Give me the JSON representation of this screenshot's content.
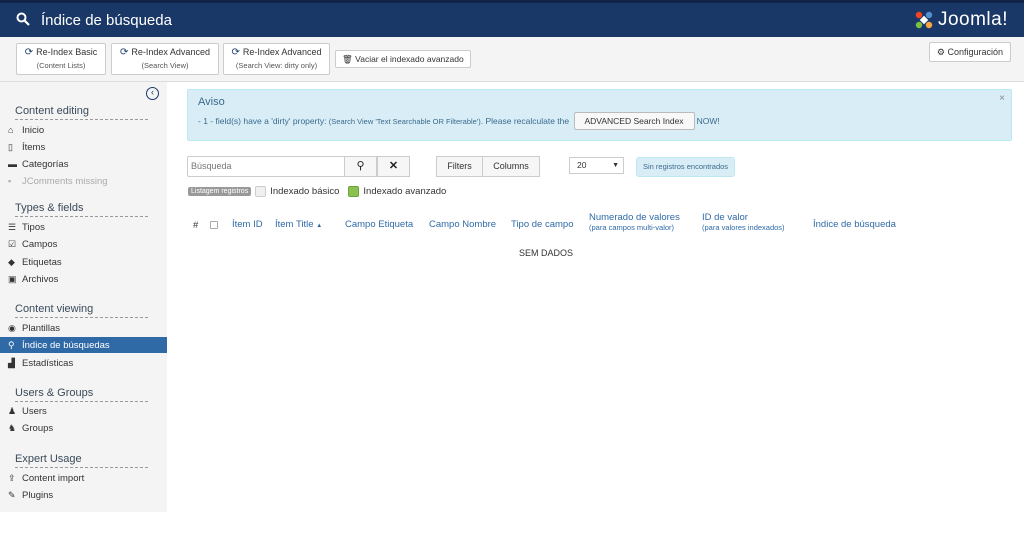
{
  "header": {
    "title": "Índice de búsqueda",
    "logo_text": "Joomla!"
  },
  "toolbar": {
    "btn_reindex_basic": {
      "label": "Re-Index Basic",
      "sub": "(Content Lists)"
    },
    "btn_reindex_advanced": {
      "label": "Re-Index Advanced",
      "sub": "(Search View)"
    },
    "btn_reindex_advanced_dirty": {
      "label": "Re-Index Advanced",
      "sub": "(Search View: dirty only)"
    },
    "btn_empty_advanced": "Vaciar el indexado avanzado",
    "btn_config": "Configuración"
  },
  "sidebar": {
    "sections": [
      {
        "title": "Content editing",
        "items": [
          {
            "label": "Inicio",
            "icon": "home-icon"
          },
          {
            "label": "Ítems",
            "icon": "file-icon"
          },
          {
            "label": "Categorías",
            "icon": "folder-icon"
          },
          {
            "label": "JComments missing",
            "icon": "comment-icon",
            "disabled": true
          }
        ]
      },
      {
        "title": "Types & fields",
        "items": [
          {
            "label": "Tipos",
            "icon": "list-icon"
          },
          {
            "label": "Campos",
            "icon": "checkbox-icon"
          },
          {
            "label": "Etiquetas",
            "icon": "tag-icon"
          },
          {
            "label": "Archivos",
            "icon": "image-icon"
          }
        ]
      },
      {
        "title": "Content viewing",
        "items": [
          {
            "label": "Plantillas",
            "icon": "eye-icon"
          },
          {
            "label": "Índice de búsquedas",
            "icon": "search-icon",
            "active": true
          },
          {
            "label": "Estadísticas",
            "icon": "chart-icon"
          }
        ]
      },
      {
        "title": "Users & Groups",
        "items": [
          {
            "label": "Users",
            "icon": "user-icon"
          },
          {
            "label": "Groups",
            "icon": "users-icon"
          }
        ]
      },
      {
        "title": "Expert Usage",
        "items": [
          {
            "label": "Content import",
            "icon": "upload-icon"
          },
          {
            "label": "Plugins",
            "icon": "plug-icon"
          }
        ]
      }
    ]
  },
  "alert": {
    "title": "Aviso",
    "text_before": "- 1 - field(s) have a 'dirty' property: ",
    "text_small": "(Search View 'Text Searchable OR Filterable')",
    "text_middle": ". Please recalculate the",
    "button": "ADVANCED  Search Index",
    "text_after": "NOW!",
    "close": "×"
  },
  "filters": {
    "search_placeholder": "Búsqueda",
    "filters_button": "Filters",
    "columns_button": "Columns",
    "limit_value": "20",
    "no_records": "Sin registros encontrados"
  },
  "legend": {
    "badge": "Listagem registros",
    "basic": "Indexado básico",
    "advanced": "Indexado avanzado"
  },
  "table": {
    "columns": {
      "hash": "#",
      "item_id": "Ítem ID",
      "item_title": "Ítem Title",
      "field_label": "Campo Etiqueta",
      "field_name": "Campo Nombre",
      "field_type": "Tipo de campo",
      "value_count": "Numerado de valores",
      "value_count_sub": "(para campos multi-valor)",
      "value_id": "ID de valor",
      "value_id_sub": "(para valores indexados)",
      "search_index": "Índice de búsqueda"
    },
    "sort_indicator": "▲",
    "empty": "SEM DADOS"
  }
}
